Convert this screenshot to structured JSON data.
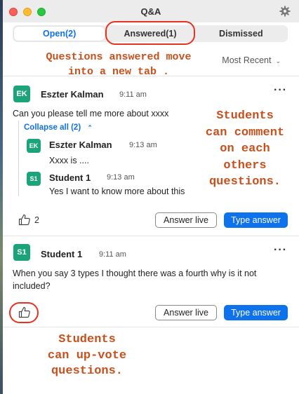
{
  "window": {
    "title": "Q&A"
  },
  "tabs": [
    {
      "label": "Open(2)",
      "active": true
    },
    {
      "label": "Answered(1)",
      "active": false
    },
    {
      "label": "Dismissed",
      "active": false
    }
  ],
  "sort": {
    "label": "Most Recent"
  },
  "questions": [
    {
      "avatar": "EK",
      "avatar_color": "#1ba37a",
      "name": "Eszter Kalman",
      "time": "9:11 am",
      "text": "Can you please tell me more about xxxx",
      "collapse_label": "Collapse all (2)",
      "replies": [
        {
          "avatar": "EK",
          "avatar_color": "#1ba37a",
          "name": "Eszter Kalman",
          "time": "9:13 am",
          "text": "Xxxx is ...."
        },
        {
          "avatar": "S1",
          "avatar_color": "#1ba37a",
          "name": "Student 1",
          "time": "9:13 am",
          "text": "Yes I want to know more about this"
        }
      ],
      "likes": "2",
      "answer_live_label": "Answer live",
      "type_answer_label": "Type answer"
    },
    {
      "avatar": "S1",
      "avatar_color": "#1ba37a",
      "name": "Student 1",
      "time": "9:11 am",
      "text_line1": "When you say 3 types I thought there was a fourth why is it not",
      "text_line2": "included?",
      "answer_live_label": "Answer live",
      "type_answer_label": "Type answer"
    }
  ],
  "annotations": {
    "tab_note_line1": "Questions answered move",
    "tab_note_line2": "into a new tab .",
    "comment_note_line1": "Students",
    "comment_note_line2": "can comment",
    "comment_note_line3": "on each",
    "comment_note_line4": "others",
    "comment_note_line5": "questions.",
    "upvote_note_line1": "Students",
    "upvote_note_line2": "can up-vote",
    "upvote_note_line3": "questions."
  },
  "colors": {
    "accent": "#0e72ed",
    "annotation": "#c9501c",
    "highlight_oval": "#e8321e"
  }
}
